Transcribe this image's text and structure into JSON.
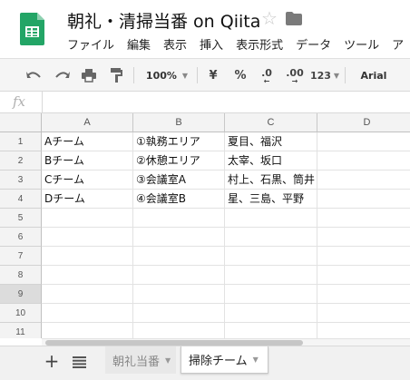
{
  "header": {
    "title": "朝礼・清掃当番 on Qiita",
    "star_icon": "star-icon",
    "folder_icon": "folder-icon",
    "menu": [
      "ファイル",
      "編集",
      "表示",
      "挿入",
      "表示形式",
      "データ",
      "ツール",
      "ア"
    ]
  },
  "toolbar": {
    "zoom": "100%",
    "currency": "¥",
    "percent": "%",
    "decrease_decimals": ".0",
    "increase_decimals": ".00",
    "number_format": "123",
    "font": "Arial",
    "icons": [
      "undo-icon",
      "redo-icon",
      "print-icon",
      "paint-format-icon"
    ]
  },
  "formula_bar": {
    "label": "fx",
    "value": ""
  },
  "grid": {
    "columns": [
      "A",
      "B",
      "C",
      "D"
    ],
    "rows": [
      "1",
      "2",
      "3",
      "4",
      "5",
      "6",
      "7",
      "8",
      "9",
      "10",
      "11"
    ],
    "selected_row": "9",
    "cells": [
      [
        "Aチーム",
        "①執務エリア",
        "夏目、福沢",
        ""
      ],
      [
        "Bチーム",
        "②休憩エリア",
        "太宰、坂口",
        ""
      ],
      [
        "Cチーム",
        "③会議室A",
        "村上、石黒、筒井",
        ""
      ],
      [
        "Dチーム",
        "④会議室B",
        "星、三島、平野",
        ""
      ]
    ]
  },
  "sheets": {
    "add_label": "+",
    "tabs": [
      {
        "label": "朝礼当番",
        "active": false
      },
      {
        "label": "掃除チーム",
        "active": true
      }
    ]
  },
  "colors": {
    "sheets_green": "#23A566",
    "header_bg": "#f3f3f3",
    "selected_row": "#dcdcdc"
  }
}
